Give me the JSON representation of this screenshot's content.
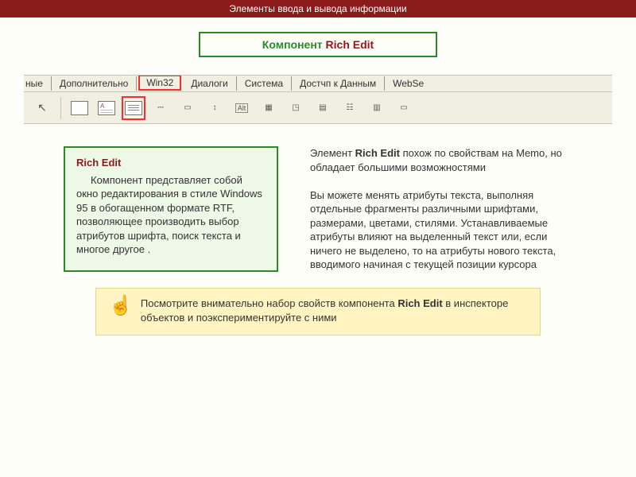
{
  "banner": "Элементы ввода и вывода информации",
  "title": {
    "prefix": "Компонент ",
    "name": "Rich Edit"
  },
  "tabs": {
    "left_partial": "ные",
    "items": [
      "Дополнительно",
      "Win32",
      "Диалоги",
      "Система",
      "Достчп к Данным",
      "WebSe"
    ],
    "selected": "Win32"
  },
  "palette_icons": [
    "cursor",
    "doc",
    "page",
    "lines",
    "rich",
    "dots",
    "bar",
    "loop",
    "alt",
    "list",
    "chart",
    "scroll",
    "cal",
    "tree"
  ],
  "desc": {
    "head": "Rich Edit",
    "body": "Компонент представляет собой окно редактирования в стиле Windows 95 в обогащенном формате RTF, позволяющее производить выбор атрибутов шрифта, поиск текста и многое другое ."
  },
  "side": {
    "p1_a": "Элемент ",
    "p1_strong": "Rich Edit",
    "p1_b": " похож по свойствам на Memo, но обладает большими возможностями",
    "p2": "Вы можете менять атрибуты текста, выполняя отдельные фрагменты различными шрифтами, размерами, цветами, стилями. Устанавливаемые атрибуты влияют на выделенный текст или, если ничего не выделено, то на атрибуты нового текста, вводимого начиная с текущей позиции курсора"
  },
  "note": {
    "a": "Посмотрите внимательно набор свойств компонента ",
    "strong": "Rich Edit",
    "b": "  в инспекторе объектов и поэкспериментируйте с ними"
  }
}
